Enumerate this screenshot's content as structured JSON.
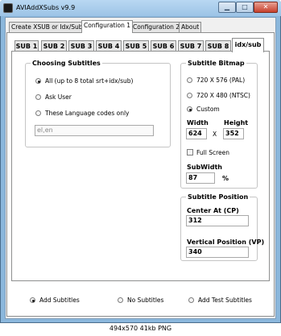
{
  "window": {
    "title": "AVIAddXSubs v9.9"
  },
  "top_tabs": [
    {
      "label": "Create XSUB or Idx/Sub"
    },
    {
      "label": "Configuration 1"
    },
    {
      "label": "Configuration 2"
    },
    {
      "label": "About"
    }
  ],
  "sub_tabs": [
    {
      "label": "SUB 1"
    },
    {
      "label": "SUB 2"
    },
    {
      "label": "SUB 3"
    },
    {
      "label": "SUB 4"
    },
    {
      "label": "SUB 5"
    },
    {
      "label": "SUB 6"
    },
    {
      "label": "SUB 7"
    },
    {
      "label": "SUB 8"
    },
    {
      "label": "idx/sub"
    }
  ],
  "choosing_subtitles": {
    "title": "Choosing Subtitles",
    "options": [
      {
        "label": "All (up to 8 total srt+idx/sub)",
        "selected": true
      },
      {
        "label": "Ask User",
        "selected": false
      },
      {
        "label": "These Language codes only",
        "selected": false
      }
    ],
    "language_codes_value": "el,en"
  },
  "subtitle_bitmap": {
    "title": "Subtitle Bitmap",
    "options": [
      {
        "label": "720 X 576 (PAL)",
        "selected": false
      },
      {
        "label": "720 X 480 (NTSC)",
        "selected": false
      },
      {
        "label": "Custom",
        "selected": true
      }
    ],
    "width_label": "Width",
    "height_label": "Height",
    "width_value": "624",
    "x_label": "X",
    "height_value": "352",
    "full_screen_label": "Full Screen",
    "full_screen_checked": false,
    "subwidth_label": "SubWidth",
    "subwidth_value": "87",
    "percent_label": "%"
  },
  "subtitle_position": {
    "title": "Subtitle Position",
    "center_label": "Center At (CP)",
    "center_value": "312",
    "vertical_label": "Vertical Position (VP)",
    "vertical_value": "340"
  },
  "bottom_options": [
    {
      "label": "Add Subtitles",
      "selected": true
    },
    {
      "label": "No Subtitles",
      "selected": false
    },
    {
      "label": "Add Test Subtitles",
      "selected": false
    }
  ],
  "image_caption": "494x570 41kb PNG"
}
